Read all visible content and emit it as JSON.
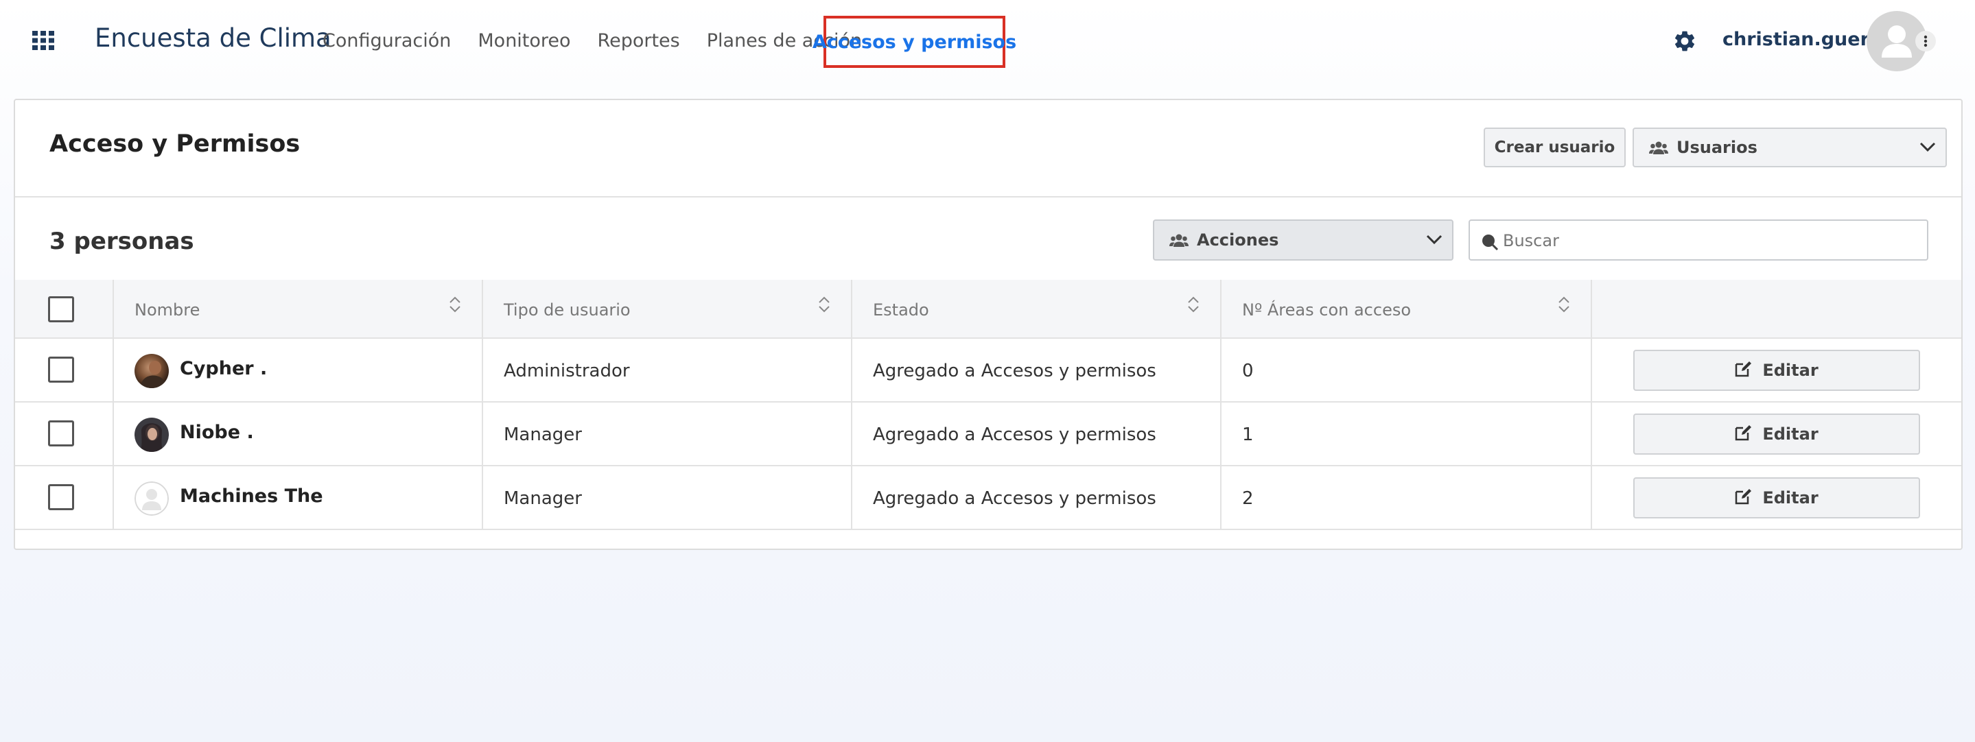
{
  "app": {
    "title": "Encuesta de Clima",
    "apps_icon": "grid-apps-icon"
  },
  "nav": {
    "items": [
      {
        "label": "Configuración"
      },
      {
        "label": "Monitoreo"
      },
      {
        "label": "Reportes"
      },
      {
        "label": "Planes de acción"
      },
      {
        "label": "Accesos y permisos",
        "active": true
      }
    ],
    "active_color": "#1a73e8",
    "highlight_color": "#d93025"
  },
  "user": {
    "name": "christian.guerra",
    "settings_icon": "gear-icon",
    "avatar_icon": "user-avatar-icon",
    "menu_icon": "kebab-menu-icon"
  },
  "header": {
    "title": "Acceso y Permisos",
    "create_button": "Crear usuario",
    "view_select": {
      "selected": "Usuarios",
      "icon": "users-icon"
    }
  },
  "toolbar": {
    "count": "3 personas",
    "actions_select": {
      "selected": "Acciones",
      "icon": "users-icon"
    },
    "search": {
      "placeholder": "Buscar",
      "value": ""
    }
  },
  "table": {
    "columns": [
      "Nombre",
      "Tipo de usuario",
      "Estado",
      "Nº Áreas con acceso",
      ""
    ],
    "rows": [
      {
        "name": "Cypher .",
        "type": "Administrador",
        "status": "Agregado a Accesos y permisos",
        "areas": "0",
        "action": "Editar",
        "avatar": "photo"
      },
      {
        "name": "Niobe .",
        "type": "Manager",
        "status": "Agregado a Accesos y permisos",
        "areas": "1",
        "action": "Editar",
        "avatar": "photo"
      },
      {
        "name": "Machines The",
        "type": "Manager",
        "status": "Agregado a Accesos y permisos",
        "areas": "2",
        "action": "Editar",
        "avatar": "placeholder"
      }
    ]
  }
}
